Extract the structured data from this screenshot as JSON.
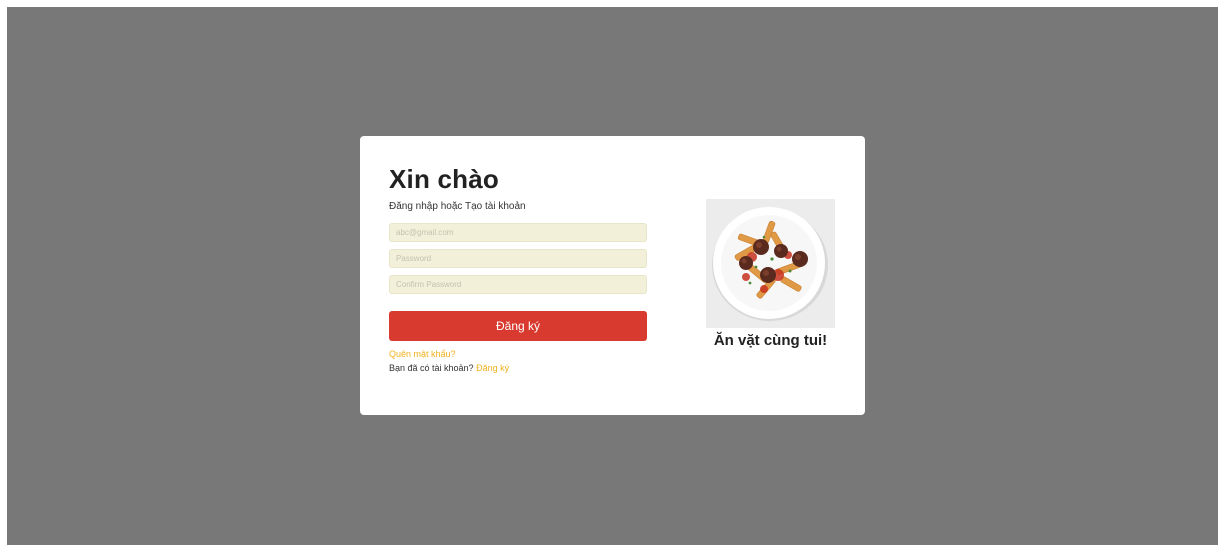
{
  "form": {
    "title": "Xin chào",
    "subtitle": "Đăng nhập hoặc Tạo tài khoản",
    "email_placeholder": "abc@gmail.com",
    "password_placeholder": "Password",
    "confirm_placeholder": "Confirm Password",
    "submit_label": "Đăng ký",
    "forgot_label": "Quên mật khẩu?",
    "have_account_text": "Bạn đã có tài khoản?",
    "have_account_link": "Đăng ký"
  },
  "promo": {
    "caption": "Ăn vặt cùng tui!",
    "image_icon": "pasta-plate-image"
  },
  "colors": {
    "overlay": "#787878",
    "submit": "#d93a2f",
    "link": "#f0b21e",
    "field_bg": "#f2f0d8"
  }
}
